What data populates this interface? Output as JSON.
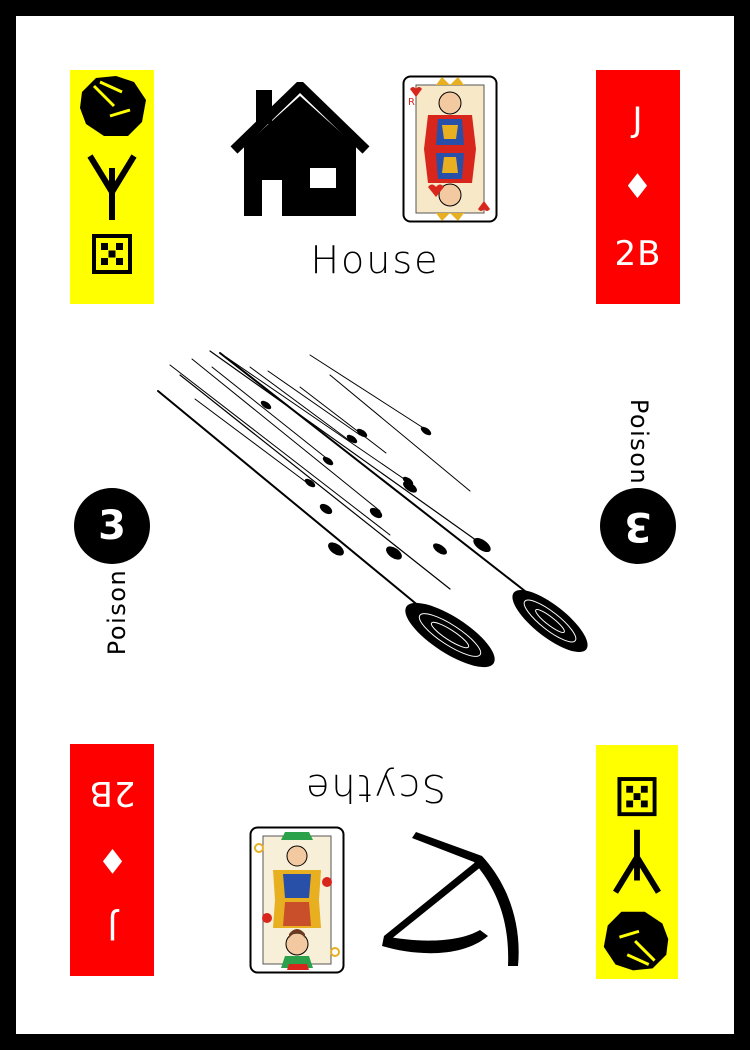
{
  "card": {
    "top_label": "House",
    "bottom_label": "Scythe",
    "left_badge": {
      "value": "3",
      "text": "Poison"
    },
    "right_badge": {
      "value": "3",
      "text": "Poison"
    },
    "suit_corner": {
      "rank": "J",
      "suit": "♦",
      "code": "2B"
    },
    "colors": {
      "suit_strip": "#ff0000",
      "symbol_strip": "#ffff00",
      "border": "#000000"
    },
    "icons": [
      "rock-icon",
      "branch-rune-icon",
      "dice-five-icon",
      "house-icon",
      "queen-card-icon",
      "jack-card-icon",
      "scythe-icon",
      "rain-streaks-illustration"
    ]
  }
}
